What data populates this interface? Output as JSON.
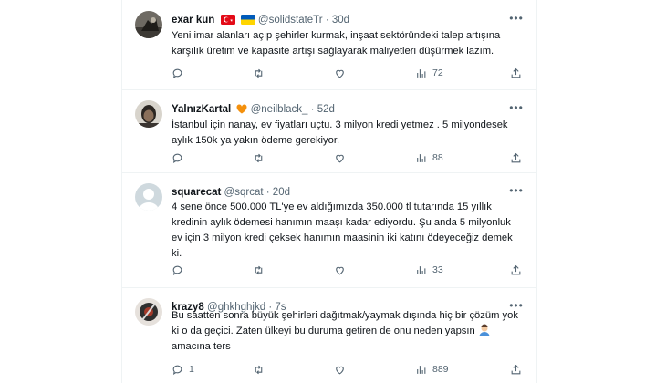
{
  "tweets": [
    {
      "name": "exar kun",
      "handle": "@solidstateTr",
      "age": "30d",
      "text": "Yeni imar alanları açıp şehirler kurmak, inşaat sektöründeki talep artışına karşılık üretim ve kapasite artışı sağlayarak maliyetleri düşürmek lazım.",
      "replies": "",
      "retweets": "",
      "likes": "",
      "views": "72"
    },
    {
      "name": "YalnızKartal",
      "handle": "@neilblack_",
      "age": "52d",
      "text": "İstanbul için nanay, ev fiyatları uçtu. 3 milyon kredi yetmez . 5 milyondesek aylık 150k ya yakın ödeme gerekiyor.",
      "replies": "",
      "retweets": "",
      "likes": "",
      "views": "88"
    },
    {
      "name": "squarecat",
      "handle": "@sqrcat",
      "age": "20d",
      "text": "4 sene önce 500.000 TL'ye ev aldığımızda 350.000 tl tutarında 15 yıllık kredinin aylık ödemesi hanımın maaşı kadar ediyordu. Şu anda 5 milyonluk ev için 3 milyon kredi çeksek hanımın maasinin iki katını ödeyeceğiz demek ki.",
      "replies": "",
      "retweets": "",
      "likes": "",
      "views": "33"
    },
    {
      "name": "krazy8",
      "handle": "@ghkhghjkd",
      "age": "7s",
      "text": "Bu saatten sonra büyük şehirleri dağıtmak/yaymak dışında hiç bir çözüm yok ki o da geçici. Zaten ülkeyi bu duruma getiren de onu neden yapsın",
      "text_end": "amacına ters",
      "replies": "1",
      "retweets": "",
      "likes": "",
      "views": "889"
    }
  ],
  "icons": {
    "reply": "reply-icon",
    "retweet": "retweet-icon",
    "like": "heart-icon",
    "views": "views-icon",
    "share": "share-icon",
    "more": "more-icon"
  },
  "colors": {
    "border": "#eff3f4",
    "muted": "#536471",
    "text": "#0f1419",
    "heart_badge": "#f4900c"
  }
}
